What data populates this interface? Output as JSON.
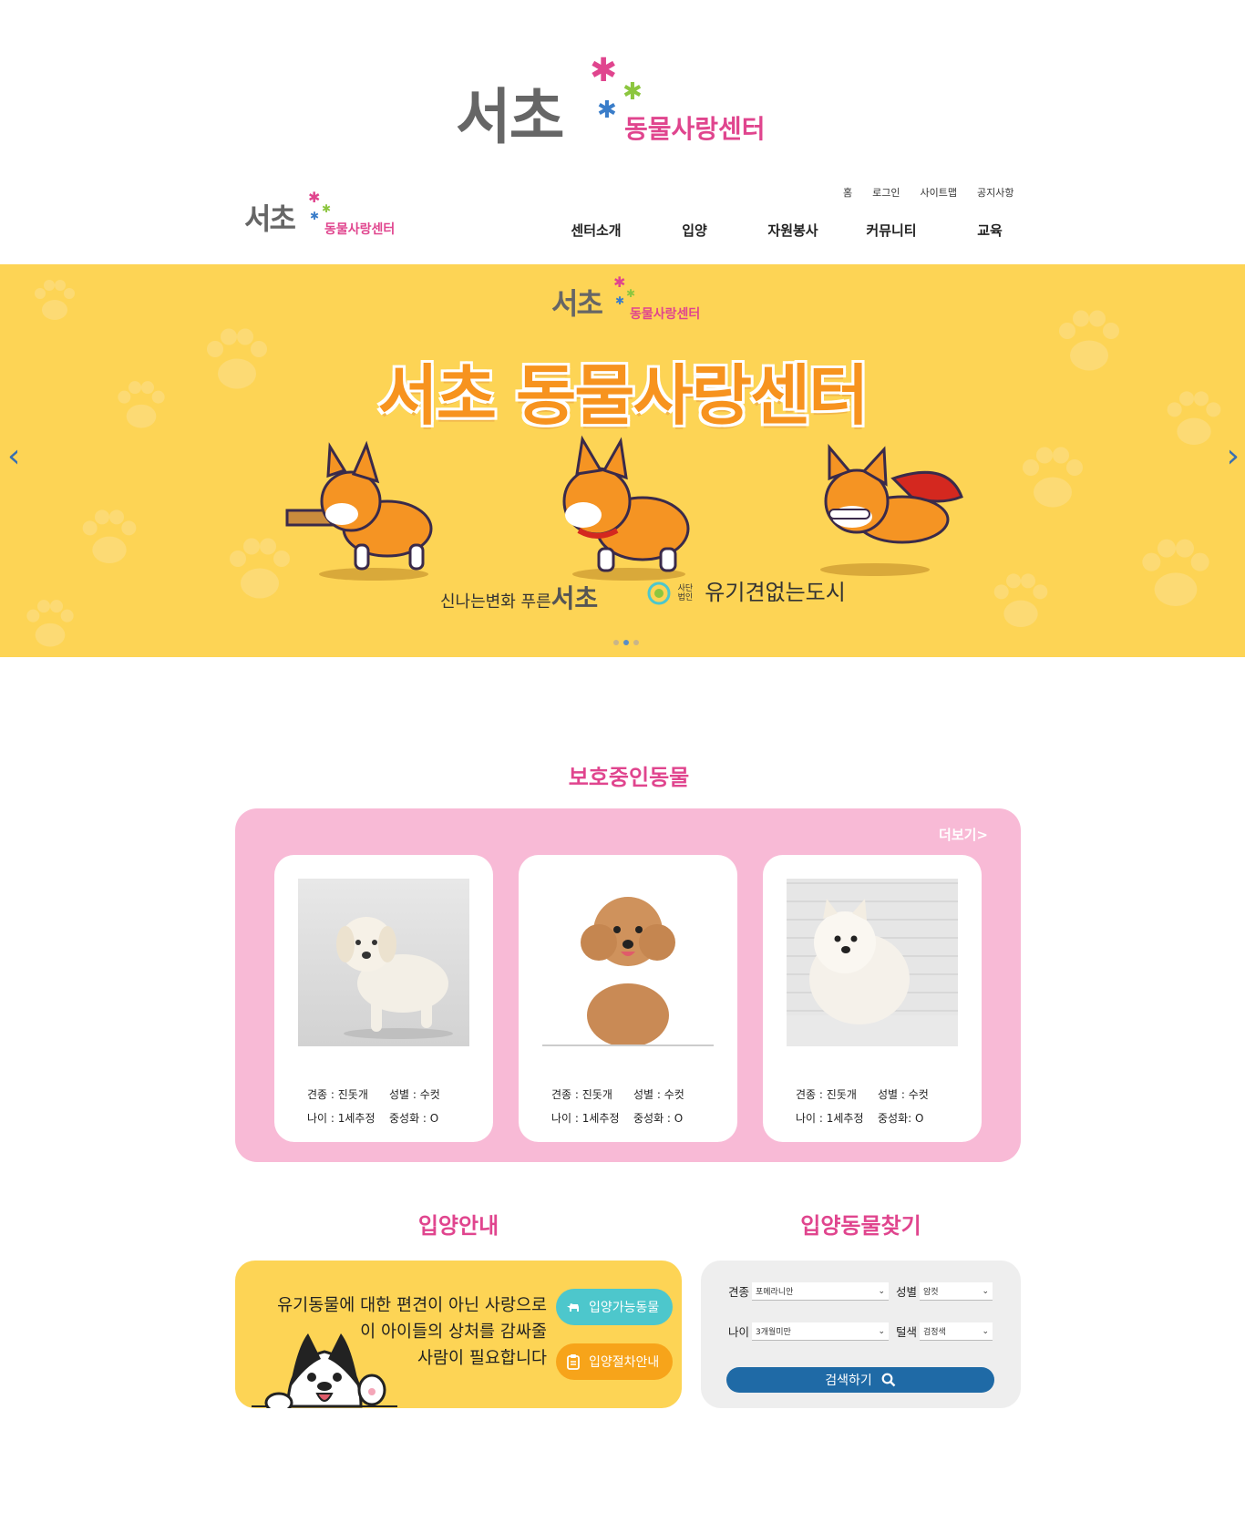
{
  "brand": {
    "logo_main": "서초",
    "logo_sub": "동물사랑센터"
  },
  "util_nav": [
    "홈",
    "로그인",
    "사이트맵",
    "공지사항"
  ],
  "main_nav": [
    "센터소개",
    "입양",
    "자원봉사",
    "커뮤니티",
    "교육"
  ],
  "banner": {
    "title": "서초 동물사랑센터",
    "slogan_left_small": "신나는변화 푸른",
    "slogan_left_big": "서초",
    "slogan_right": "유기견없는도시",
    "slogan_right_small": "사단법인",
    "prev_arrow": "‹",
    "next_arrow": "›",
    "slide_count": 3,
    "active_slide": 2
  },
  "protected_animals": {
    "title": "보호중인동물",
    "more_label": "더보기>",
    "animals": [
      {
        "breed": "견종 : 진돗개",
        "sex": "성별 : 수컷",
        "age": "나이 : 1세추정",
        "neutered": "중성화 : O"
      },
      {
        "breed": "견종 : 진돗개",
        "sex": "성별 : 수컷",
        "age": "나이 : 1세추정",
        "neutered": "중성화 : O"
      },
      {
        "breed": "견종 : 진돗개",
        "sex": "성별 : 수컷",
        "age": "나이 : 1세추정",
        "neutered": "중성화: O"
      }
    ]
  },
  "adoption_guide": {
    "title": "입양안내",
    "line1": "유기동물에 대한 편견이 아닌 사랑으로",
    "line2": "이 아이들의 상처를 감싸줄",
    "line3": "사람이 필요합니다",
    "button1": "입양가능동물",
    "button2": "입양절차안내"
  },
  "find_animal": {
    "title": "입양동물찾기",
    "breed_label": "견종",
    "breed_value": "포메라니안",
    "sex_label": "성별",
    "sex_value": "암컷",
    "age_label": "나이",
    "age_value": "3개월미만",
    "color_label": "털색",
    "color_value": "검정색",
    "search_label": "검색하기"
  }
}
